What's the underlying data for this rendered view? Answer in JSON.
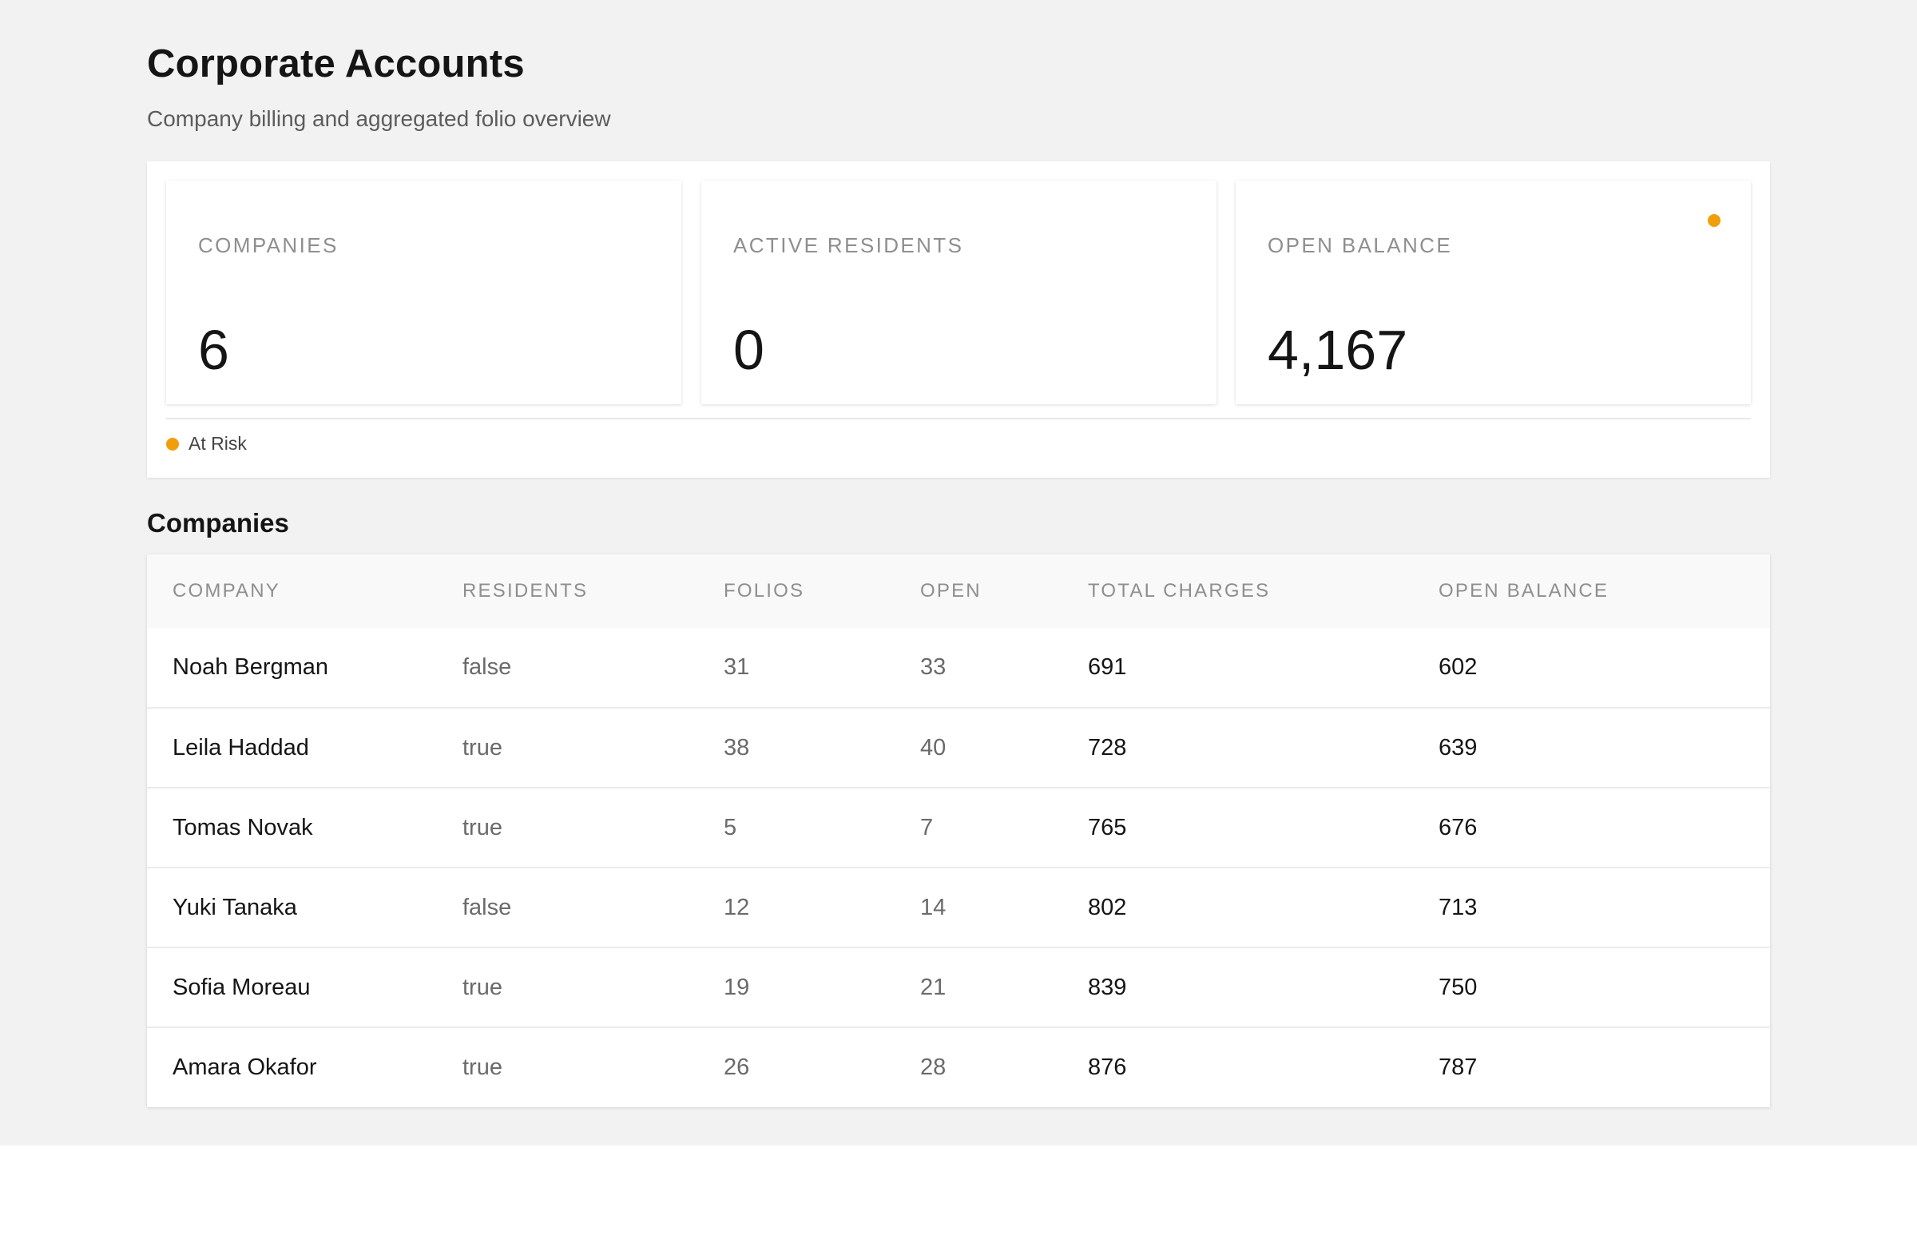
{
  "page": {
    "title": "Corporate Accounts",
    "subtitle": "Company billing and aggregated folio overview"
  },
  "kpis": [
    {
      "label": "COMPANIES",
      "value": "6",
      "flag": null
    },
    {
      "label": "ACTIVE RESIDENTS",
      "value": "0",
      "flag": null
    },
    {
      "label": "OPEN BALANCE",
      "value": "4,167",
      "flag": "at-risk"
    }
  ],
  "legend": {
    "label": "At Risk",
    "color": "#f29d0c"
  },
  "colors": {
    "at_risk": "#f29d0c"
  },
  "companies_section": {
    "title": "Companies",
    "columns": [
      "COMPANY",
      "RESIDENTS",
      "FOLIOS",
      "OPEN",
      "TOTAL CHARGES",
      "OPEN BALANCE"
    ],
    "rows": [
      {
        "company": "Noah Bergman",
        "residents": "false",
        "folios": "31",
        "open": "33",
        "total_charges": "691",
        "open_balance": "602"
      },
      {
        "company": "Leila Haddad",
        "residents": "true",
        "folios": "38",
        "open": "40",
        "total_charges": "728",
        "open_balance": "639"
      },
      {
        "company": "Tomas Novak",
        "residents": "true",
        "folios": "5",
        "open": "7",
        "total_charges": "765",
        "open_balance": "676"
      },
      {
        "company": "Yuki Tanaka",
        "residents": "false",
        "folios": "12",
        "open": "14",
        "total_charges": "802",
        "open_balance": "713"
      },
      {
        "company": "Sofia Moreau",
        "residents": "true",
        "folios": "19",
        "open": "21",
        "total_charges": "839",
        "open_balance": "750"
      },
      {
        "company": "Amara Okafor",
        "residents": "true",
        "folios": "26",
        "open": "28",
        "total_charges": "876",
        "open_balance": "787"
      }
    ]
  }
}
